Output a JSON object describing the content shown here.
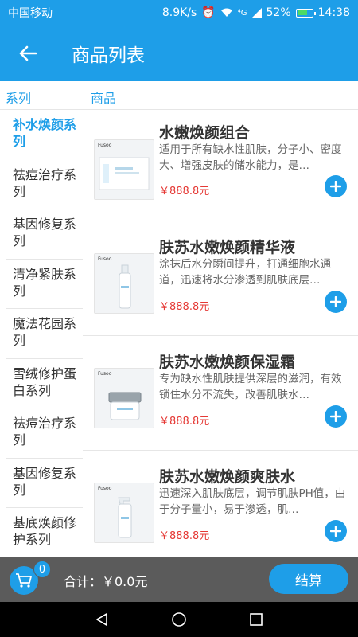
{
  "status_bar": {
    "carrier": "中国移动",
    "speed": "8.9K/s",
    "signal": "⁴G",
    "battery": "52%",
    "time": "14:38"
  },
  "app_bar": {
    "title": "商品列表"
  },
  "columns": {
    "series": "系列",
    "products": "商品"
  },
  "sidebar": {
    "items": [
      {
        "label": "补水焕颜系列"
      },
      {
        "label": "祛痘治疗系列"
      },
      {
        "label": "基因修复系列"
      },
      {
        "label": "清净紧肤系列"
      },
      {
        "label": "魔法花园系列"
      },
      {
        "label": "雪绒修护蛋白系列"
      },
      {
        "label": "祛痘治疗系列"
      },
      {
        "label": "基因修复系列"
      },
      {
        "label": "基底焕颜修护系列"
      }
    ]
  },
  "products": [
    {
      "name": "水嫩焕颜组合",
      "desc": "适用于所有缺水性肌肤，分子小、密度大、增强皮肤的储水能力，是…",
      "price": "￥888.8元"
    },
    {
      "name": "肤苏水嫩焕颜精华液",
      "desc": "涂抹后水分瞬间提升，打通细胞水通道，迅速将水分渗透到肌肤底层…",
      "price": "￥888.8元"
    },
    {
      "name": "肤苏水嫩焕颜保湿霜",
      "desc": "专为缺水性肌肤提供深层的滋润，有效锁住水分不流失，改善肌肤水…",
      "price": "￥888.8元"
    },
    {
      "name": "肤苏水嫩焕颜爽肤水",
      "desc": "迅速深入肌肤底层，调节肌肤PH值，由于分子量小，易于渗透，肌…",
      "price": "￥888.8元"
    }
  ],
  "thumb_brand": "Fusoo",
  "cart": {
    "count": "0",
    "total_label": "合计：￥0.0元",
    "checkout": "结算"
  },
  "colors": {
    "primary": "#1e9ee8",
    "price": "#e53935",
    "footer": "#5b5b5b"
  }
}
